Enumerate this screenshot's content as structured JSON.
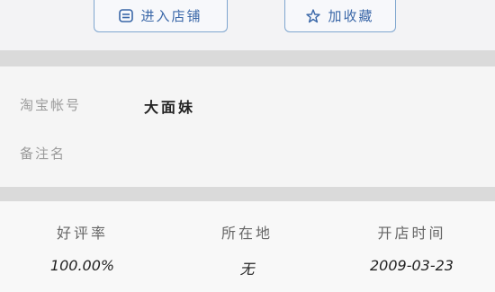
{
  "actions": {
    "enter_shop_label": "进入店铺",
    "add_favorite_label": "加收藏"
  },
  "account": {
    "taobao_id_label": "淘宝帐号",
    "taobao_id_value": "大面妹",
    "remark_label": "备注名",
    "remark_value": ""
  },
  "stats": {
    "rating_label": "好评率",
    "rating_value": "100.00%",
    "location_label": "所在地",
    "location_value": "无",
    "open_date_label": "开店时间",
    "open_date_value": "2009-03-23"
  },
  "icons": {
    "shop": "shop-icon",
    "star": "star-icon"
  },
  "colors": {
    "accent": "#3a67a8",
    "button_border": "#7fa6cf",
    "separator": "#dadada"
  }
}
